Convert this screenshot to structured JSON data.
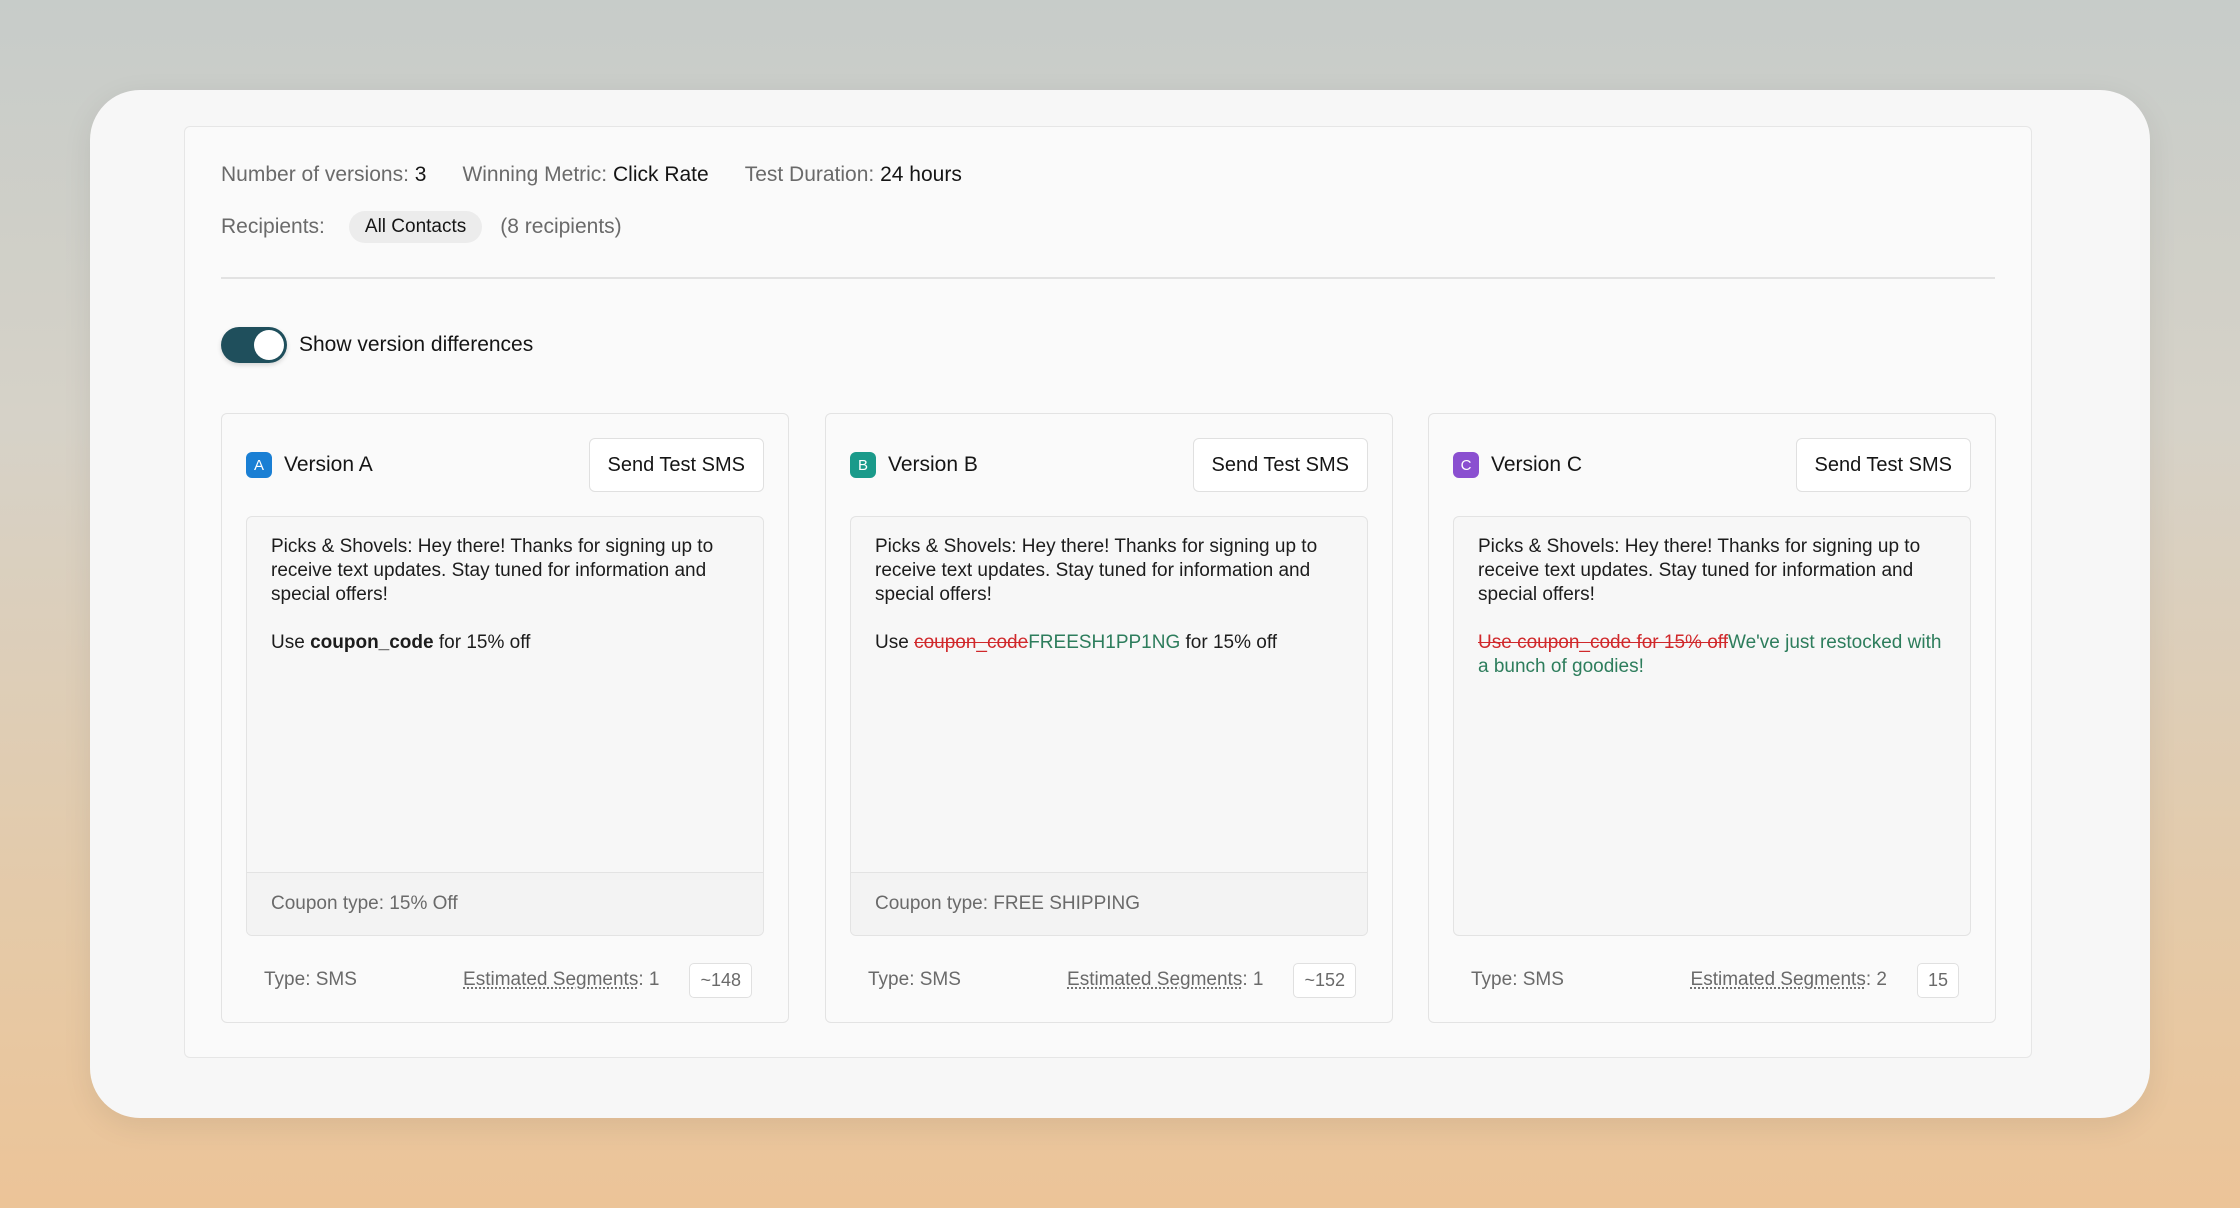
{
  "summary": {
    "versions_label": "Number of versions:",
    "versions_value": "3",
    "metric_label": "Winning Metric:",
    "metric_value": "Click Rate",
    "duration_label": "Test Duration:",
    "duration_value": "24 hours",
    "recipients_label": "Recipients:",
    "recipients_chip": "All Contacts",
    "recipients_count": "(8 recipients)"
  },
  "toggle": {
    "label": "Show version differences",
    "on": true
  },
  "colors": {
    "toggle_on": "#1f4f5c",
    "badge_a": "#1a7fd4",
    "badge_b": "#1a9a8a",
    "badge_c": "#8a4fd0",
    "deleted_text": "#d0282b",
    "inserted_text": "#2d7d5c"
  },
  "versions": [
    {
      "badge": "A",
      "name": "Version A",
      "send_label": "Send Test SMS",
      "body": "Picks & Shovels: Hey there! Thanks for signing up to receive text updates. Stay tuned for information and special offers!",
      "line2_prefix": "Use ",
      "line2_code": "coupon_code",
      "line2_suffix": " for 15% off",
      "coupon_type": "Coupon type: 15% Off",
      "type": "Type: SMS",
      "segments_label": "Estimated Segments",
      "segments_value": ": 1",
      "char_count": "~148"
    },
    {
      "badge": "B",
      "name": "Version B",
      "send_label": "Send Test SMS",
      "body": "Picks & Shovels: Hey there! Thanks for signing up to receive text updates. Stay tuned for information and special offers!",
      "line2_prefix": "Use ",
      "line2_deleted": "coupon_code",
      "line2_inserted": "FREESH1PP1NG",
      "line2_suffix": " for 15% off",
      "coupon_type": "Coupon type: FREE SHIPPING",
      "type": "Type: SMS",
      "segments_label": "Estimated Segments",
      "segments_value": ": 1",
      "char_count": "~152"
    },
    {
      "badge": "C",
      "name": "Version C",
      "send_label": "Send Test SMS",
      "body": "Picks & Shovels: Hey there! Thanks for signing up to receive text updates. Stay tuned for information and special offers!",
      "line2_deleted": "Use coupon_code for 15% off",
      "line2_inserted": "We've just restocked with a bunch of goodies!",
      "type": "Type: SMS",
      "segments_label": "Estimated Segments",
      "segments_value": ": 2",
      "char_count": "15"
    }
  ]
}
